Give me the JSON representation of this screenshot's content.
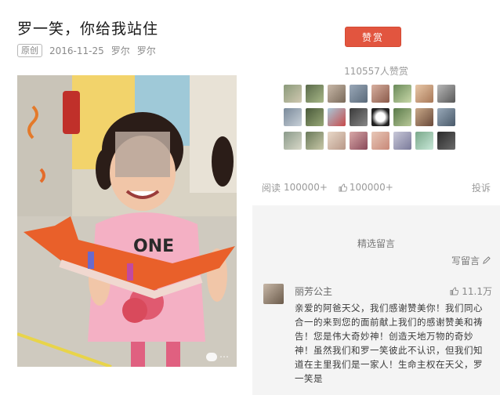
{
  "article": {
    "title": "罗一笑，你给我站住",
    "original_tag": "原创",
    "date": "2016-11-25",
    "author_1": "罗尔",
    "author_2": "罗尔"
  },
  "photo": {
    "watermark_icon": "wechat-icon"
  },
  "reward": {
    "button_label": "赞赏",
    "count_text": "110557人赞赏",
    "button_color": "#e2553f"
  },
  "stats": {
    "read_label": "阅读",
    "read_count": "100000+",
    "like_count": "100000+",
    "report_label": "投诉"
  },
  "comments_section": {
    "title": "精选留言",
    "write_label": "写留言",
    "comment": {
      "name": "丽芳公主",
      "likes": "11.1万",
      "text": "亲爱的阿爸天父，我们感谢赞美你！我们同心合一的来到您的面前献上我们的感谢赞美和祷告！您是伟大奇妙神！创造天地万物的奇妙神！虽然我们和罗一笑彼此不认识，但我们知道在主里我们是一家人！生命主权在天父，罗一笑是"
    }
  }
}
